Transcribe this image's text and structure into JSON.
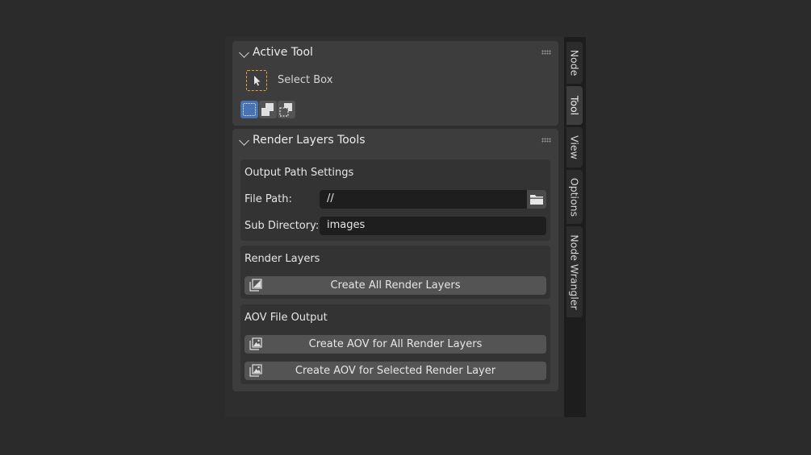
{
  "active_tool_panel": {
    "title": "Active Tool",
    "tool_name": "Select Box"
  },
  "render_layers_panel": {
    "title": "Render Layers Tools",
    "output_path": {
      "title": "Output Path Settings",
      "file_path_label": "File Path:",
      "file_path_value": "//",
      "sub_directory_label": "Sub Directory:",
      "sub_directory_value": "images"
    },
    "render_layers": {
      "title": "Render Layers",
      "create_all_label": "Create All Render Layers"
    },
    "aov_output": {
      "title": "AOV File Output",
      "create_aov_all_label": "Create AOV for All Render Layers",
      "create_aov_selected_label": "Create AOV for Selected Render Layer"
    }
  },
  "sidebar_tabs": [
    "Node",
    "Tool",
    "View",
    "Options",
    "Node Wrangler"
  ],
  "active_tab": "Tool",
  "colors": {
    "accent": "#4772b3",
    "select_box_outline": "#e8a23a"
  },
  "icons": {
    "collapse": "chevron-down-icon",
    "drag": "grip-icon",
    "select_box": "select-box-icon",
    "folder": "folder-icon",
    "render_layer": "image-layer-icon"
  }
}
